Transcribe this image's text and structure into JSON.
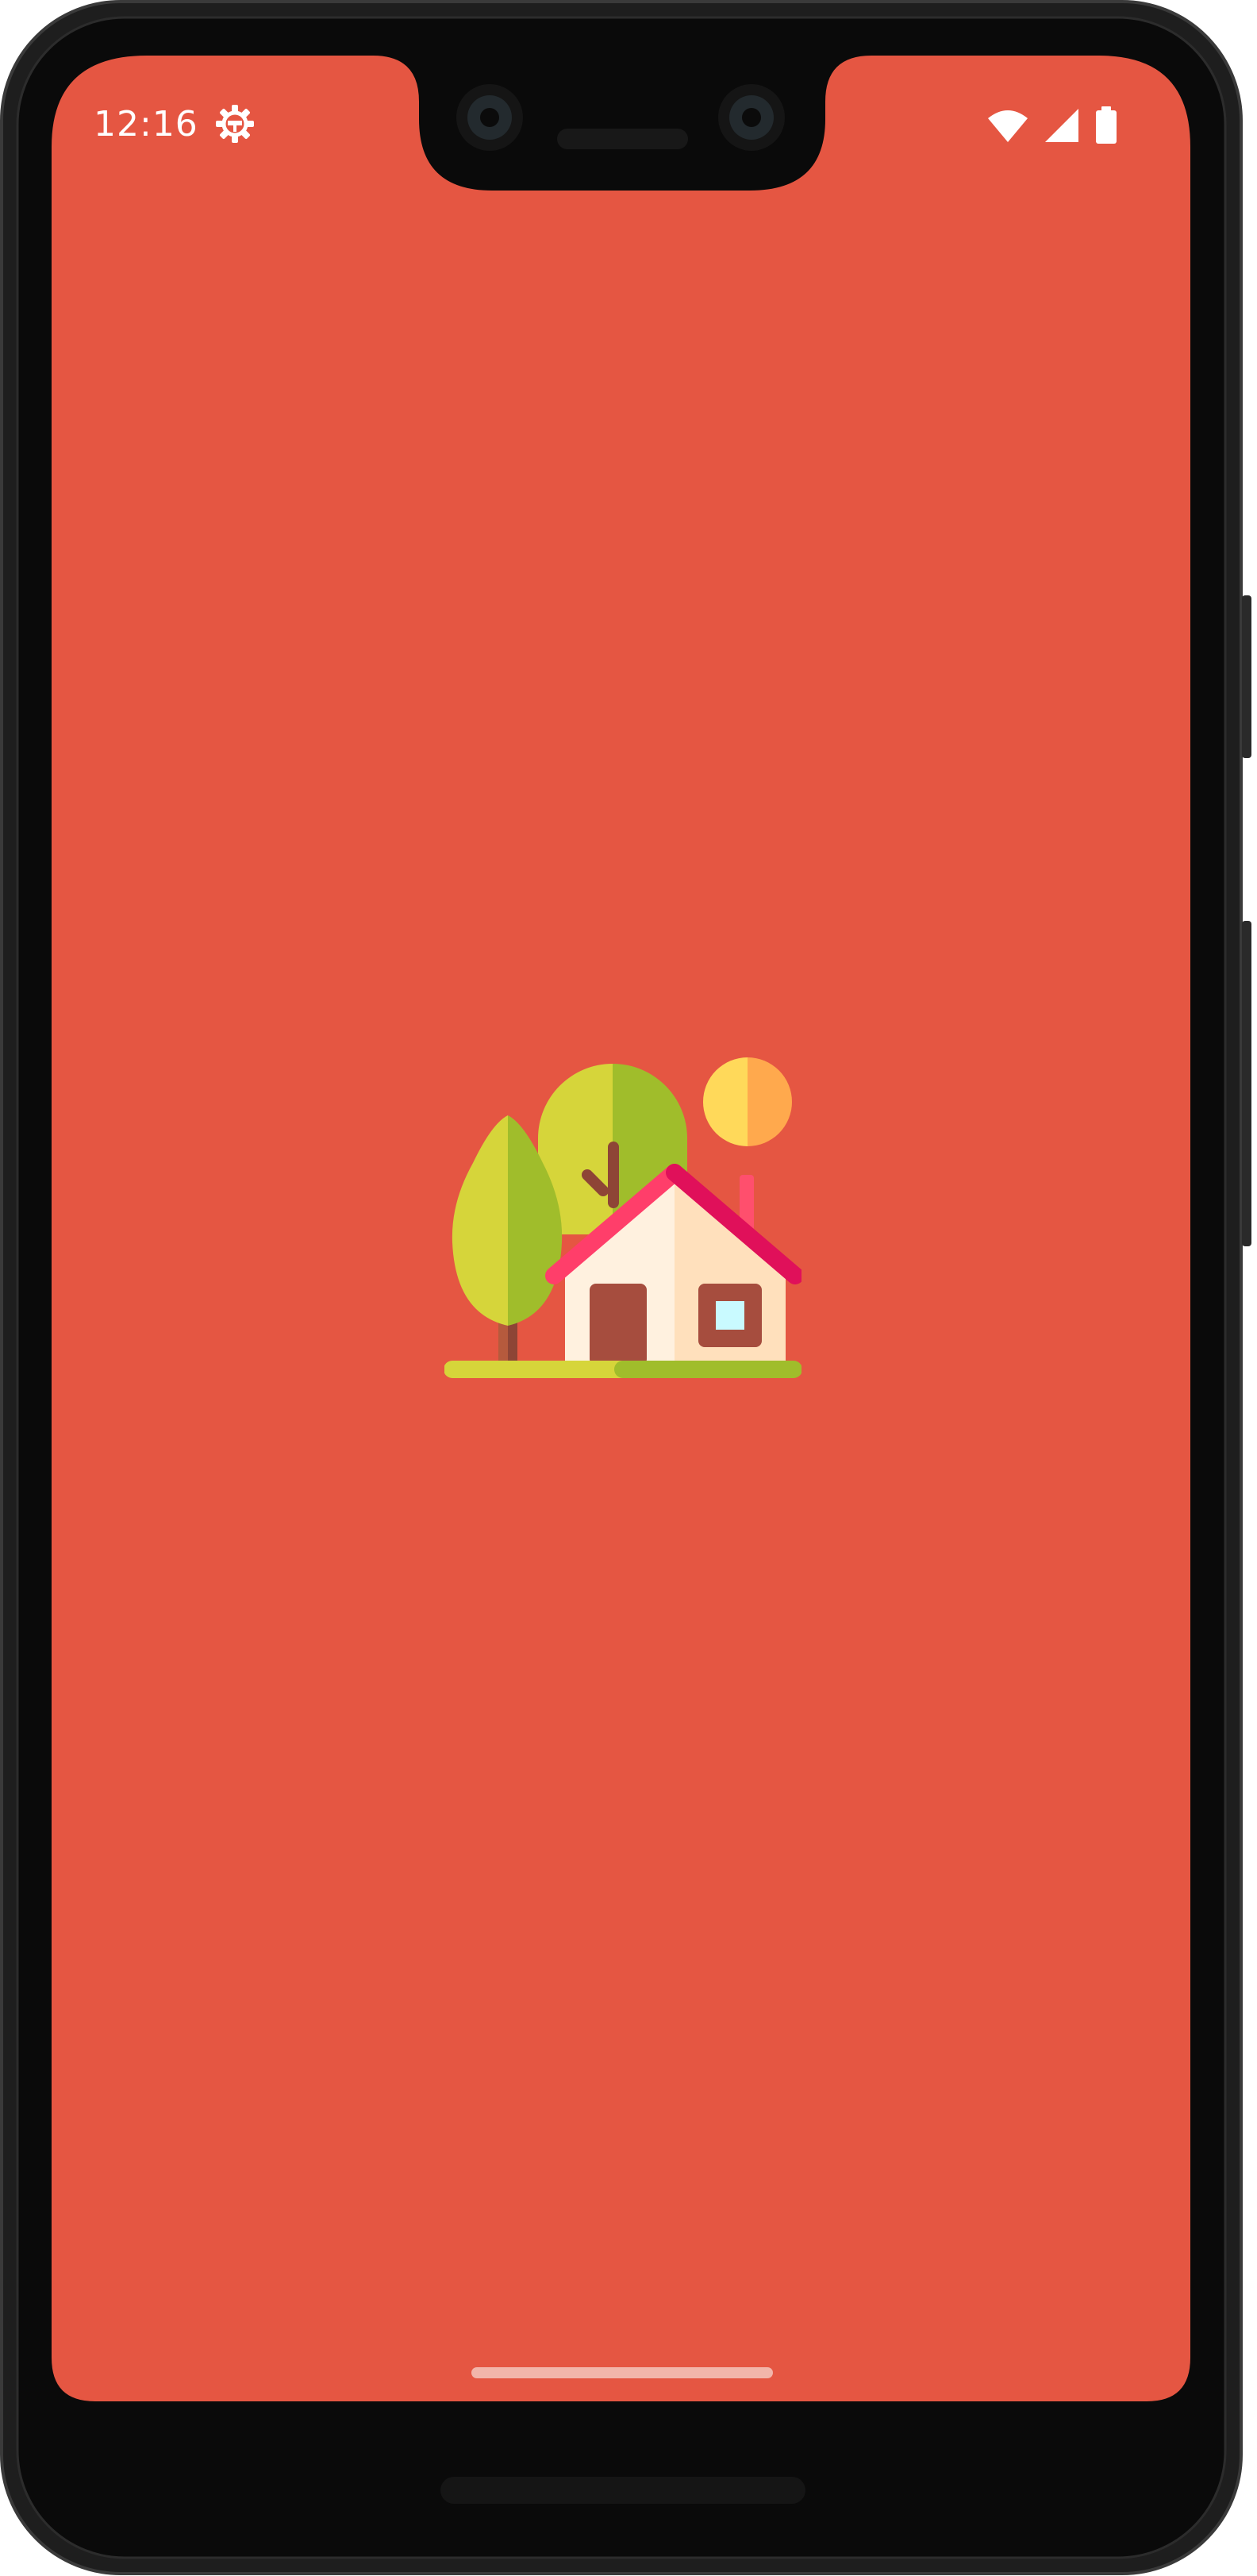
{
  "statusbar": {
    "time": "12:16",
    "settings_icon": "gear-icon",
    "wifi_icon": "wifi-icon",
    "signal_icon": "cell-signal-icon",
    "battery_icon": "battery-icon"
  },
  "screen": {
    "background_color": "#E55642",
    "logo_icon": "house-with-trees-icon"
  },
  "navigation": {
    "gesture_bar": "home-indicator"
  },
  "colors": {
    "frame": "#1b1b1b",
    "bezel": "#0a0a0a",
    "accent": "#E55642",
    "house_roof": "#E0105A",
    "house_wall": "#FFE4C8",
    "door": "#A64D3E",
    "tree_light": "#D6D53A",
    "tree_dark": "#A0BD2B",
    "sun_light": "#FFD95A",
    "sun_dark": "#FFA94D"
  }
}
